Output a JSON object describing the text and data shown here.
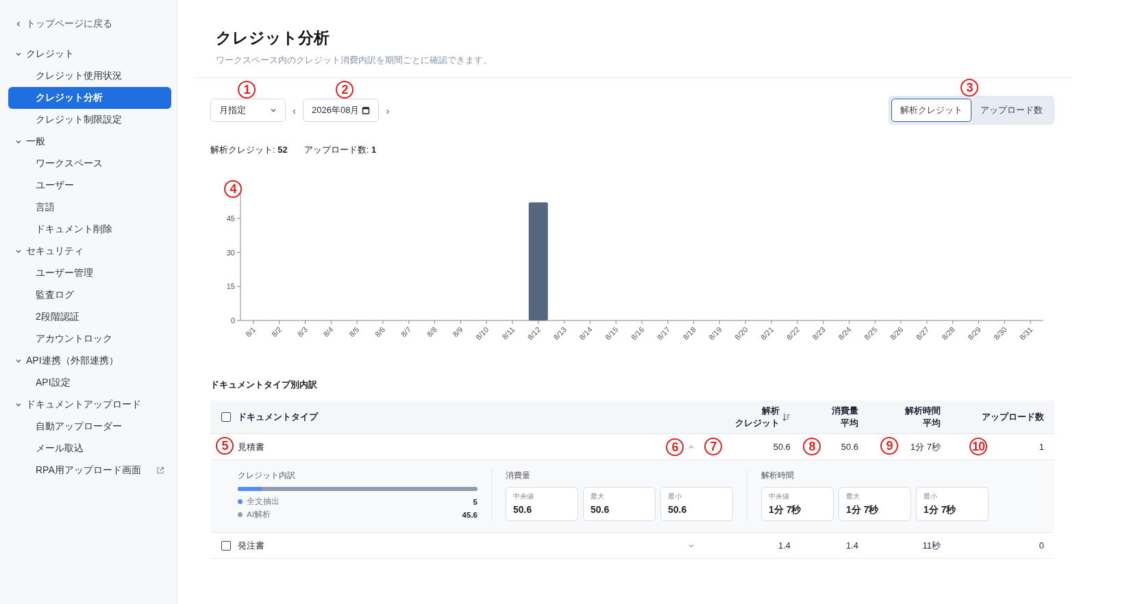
{
  "sidebar": {
    "back_link": "トップページに戻る",
    "groups": [
      {
        "label": "クレジット",
        "expanded": true,
        "items": [
          {
            "label": "クレジット使用状況",
            "selected": false,
            "kind": "link"
          },
          {
            "label": "クレジット分析",
            "selected": true,
            "kind": "link"
          },
          {
            "label": "クレジット制限設定",
            "selected": false,
            "kind": "link"
          }
        ]
      },
      {
        "label": "一般",
        "expanded": true,
        "items": [
          {
            "label": "ワークスペース",
            "selected": false,
            "kind": "link"
          },
          {
            "label": "ユーザー",
            "selected": false,
            "kind": "link"
          },
          {
            "label": "言語",
            "selected": false,
            "kind": "link"
          },
          {
            "label": "ドキュメント削除",
            "selected": false,
            "kind": "link"
          }
        ]
      },
      {
        "label": "セキュリティ",
        "expanded": true,
        "items": [
          {
            "label": "ユーザー管理",
            "selected": false,
            "kind": "link"
          },
          {
            "label": "監査ログ",
            "selected": false,
            "kind": "link"
          },
          {
            "label": "2段階認証",
            "selected": false,
            "kind": "link"
          },
          {
            "label": "アカウントロック",
            "selected": false,
            "kind": "link"
          }
        ]
      },
      {
        "label": "API連携（外部連携）",
        "expanded": true,
        "items": [
          {
            "label": "API設定",
            "selected": false,
            "kind": "link"
          }
        ]
      },
      {
        "label": "ドキュメントアップロード",
        "expanded": true,
        "items": [
          {
            "label": "自動アップローダー",
            "selected": false,
            "kind": "link"
          },
          {
            "label": "メール取込",
            "selected": false,
            "kind": "link"
          },
          {
            "label": "RPA用アップロード画面",
            "selected": false,
            "kind": "external"
          }
        ]
      }
    ]
  },
  "header": {
    "title": "クレジット分析",
    "subtitle": "ワークスペース内のクレジット消費内訳を期間ごとに確認できます。"
  },
  "controls": {
    "period_select": {
      "value": "月指定",
      "callout": "1"
    },
    "prev": "‹",
    "date_field": {
      "value": "2026年08月",
      "callout": "2"
    },
    "next": "›",
    "metric_toggle": {
      "callout": "3",
      "options": [
        {
          "label": "解析クレジット",
          "selected": true
        },
        {
          "label": "アップロード数",
          "selected": false
        }
      ]
    }
  },
  "summary": [
    {
      "label": "解析クレジット:",
      "value": "52"
    },
    {
      "label": "アップロード数:",
      "value": "1"
    }
  ],
  "chart": {
    "callout": "4",
    "chart_data": {
      "type": "bar",
      "categories": [
        "8/1",
        "8/2",
        "8/3",
        "8/4",
        "8/5",
        "8/6",
        "8/7",
        "8/8",
        "8/9",
        "8/10",
        "8/11",
        "8/12",
        "8/13",
        "8/14",
        "8/15",
        "8/16",
        "8/17",
        "8/18",
        "8/19",
        "8/20",
        "8/21",
        "8/22",
        "8/23",
        "8/24",
        "8/25",
        "8/26",
        "8/27",
        "8/28",
        "8/29",
        "8/30",
        "8/31"
      ],
      "series": [
        {
          "color": "#56667e",
          "values": [
            0,
            0,
            0,
            0,
            0,
            0,
            0,
            0,
            0,
            0,
            0,
            52,
            0,
            0,
            0,
            0,
            0,
            0,
            0,
            0,
            0,
            0,
            0,
            0,
            0,
            0,
            0,
            0,
            0,
            0,
            0
          ]
        }
      ],
      "ylim": [
        0,
        60
      ],
      "yticks": [
        0,
        15,
        30,
        45
      ]
    }
  },
  "breakdown": {
    "title": "ドキュメントタイプ別内訳",
    "select_all_checked": false,
    "columns": [
      {
        "lines": [
          "ドキュメントタイプ"
        ],
        "sorted": false
      },
      {
        "lines": [
          "解析",
          "クレジット"
        ],
        "sorted": true
      },
      {
        "lines": [
          "消費量",
          "平均"
        ],
        "sorted": false
      },
      {
        "lines": [
          "解析時間",
          "平均"
        ],
        "sorted": false
      },
      {
        "lines": [
          "アップロード数"
        ],
        "sorted": false
      }
    ],
    "rows": [
      {
        "expanded": true,
        "toggle_callout": "6",
        "cells": [
          {
            "text": "見積書",
            "callout": "5"
          },
          {
            "text": "50.6",
            "callout": "7"
          },
          {
            "text": "50.6",
            "callout": "8"
          },
          {
            "text": "1分 7秒",
            "callout": "9"
          },
          {
            "text": "1",
            "callout": "10"
          }
        ],
        "details": {
          "credit_title": "クレジット内訳",
          "credit_bar": {
            "level": 0.099
          },
          "credit_items": [
            {
              "label": "全文抽出",
              "value": "5",
              "color": "#4f8ef7"
            },
            {
              "label": "AI解析",
              "value": "45.6",
              "color": "#8e9bb0"
            }
          ],
          "stat_groups": [
            {
              "title": "消費量",
              "stats": [
                {
                  "label": "中央値",
                  "value": "50.6"
                },
                {
                  "label": "最大",
                  "value": "50.6"
                },
                {
                  "label": "最小",
                  "value": "50.6"
                }
              ]
            },
            {
              "title": "解析時間",
              "stats": [
                {
                  "label": "中央値",
                  "value": "1分 7秒"
                },
                {
                  "label": "最大",
                  "value": "1分 7秒"
                },
                {
                  "label": "最小",
                  "value": "1分 7秒"
                }
              ]
            }
          ]
        }
      },
      {
        "checked": false,
        "expanded": false,
        "cells": [
          {
            "text": "発注書"
          },
          {
            "text": "1.4"
          },
          {
            "text": "1.4"
          },
          {
            "text": "11秒"
          },
          {
            "text": "0"
          }
        ]
      }
    ]
  }
}
